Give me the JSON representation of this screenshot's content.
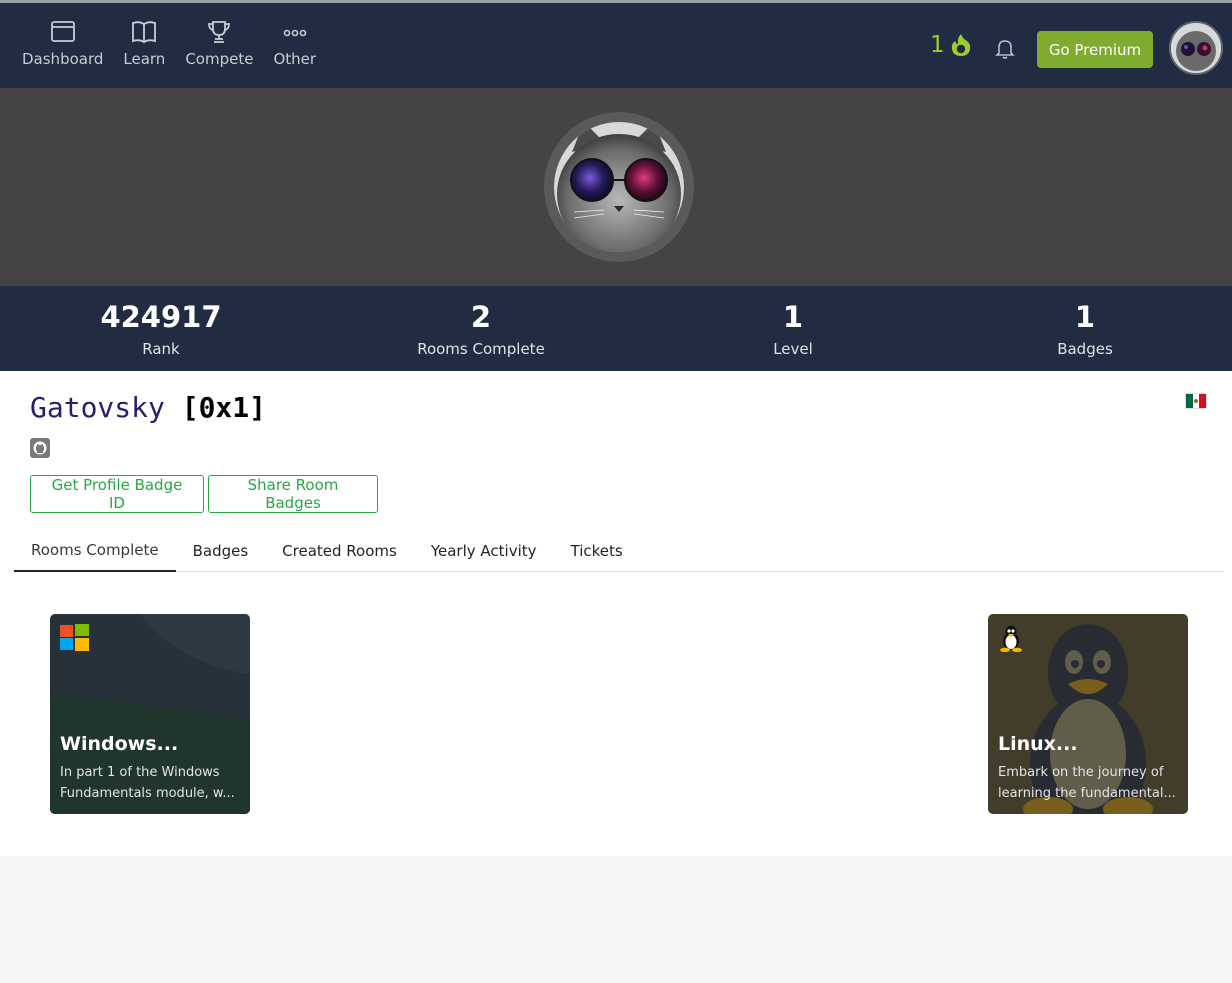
{
  "nav": {
    "items": [
      {
        "label": "Dashboard",
        "icon": "dashboard-icon"
      },
      {
        "label": "Learn",
        "icon": "book-icon"
      },
      {
        "label": "Compete",
        "icon": "trophy-icon"
      },
      {
        "label": "Other",
        "icon": "more-icon"
      }
    ],
    "streak_count": "1",
    "premium_label": "Go Premium"
  },
  "stats": [
    {
      "value": "424917",
      "label": "Rank"
    },
    {
      "value": "2",
      "label": "Rooms Complete"
    },
    {
      "value": "1",
      "label": "Level"
    },
    {
      "value": "1",
      "label": "Badges"
    }
  ],
  "profile": {
    "username": "Gatovsky",
    "tag": "[0x1]",
    "buttons": {
      "badge_id": "Get Profile Badge ID",
      "share": "Share Room Badges"
    }
  },
  "tabs": [
    {
      "label": "Rooms Complete",
      "active": true
    },
    {
      "label": "Badges"
    },
    {
      "label": "Created Rooms"
    },
    {
      "label": "Yearly Activity"
    },
    {
      "label": "Tickets"
    }
  ],
  "rooms": [
    {
      "title": "Windows...",
      "desc_line1": "In part 1 of the Windows",
      "desc_line2": "Fundamentals module, w...",
      "icon": "windows-logo-icon"
    },
    {
      "title": "Linux...",
      "desc_line1": "Embark on the journey of",
      "desc_line2": "learning the fundamental...",
      "icon": "linux-tux-icon"
    }
  ],
  "colors": {
    "nav_bg": "#212c42",
    "accent_green": "#7fab2f",
    "streak_green": "#9acd32",
    "outline_green": "#28a745"
  }
}
